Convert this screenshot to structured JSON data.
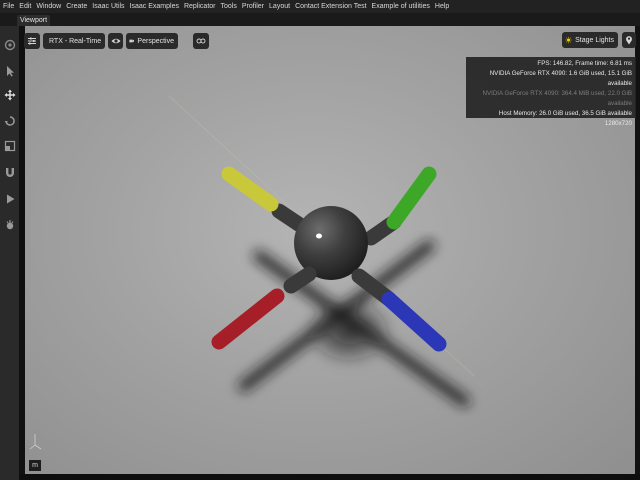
{
  "menubar": {
    "items": [
      {
        "label": "File"
      },
      {
        "label": "Edit"
      },
      {
        "label": "Window"
      },
      {
        "label": "Create"
      },
      {
        "label": "Isaac Utils"
      },
      {
        "label": "Isaac Examples"
      },
      {
        "label": "Replicator"
      },
      {
        "label": "Tools"
      },
      {
        "label": "Profiler"
      },
      {
        "label": "Layout"
      },
      {
        "label": "Contact Extension Test"
      },
      {
        "label": "Example of utilities"
      },
      {
        "label": "Help"
      }
    ]
  },
  "tabs": {
    "active": "Viewport"
  },
  "toolbar": {
    "tools": [
      {
        "icon": "orbit-icon"
      },
      {
        "icon": "select-arrow-icon"
      },
      {
        "icon": "move-icon"
      },
      {
        "icon": "rotate-icon"
      },
      {
        "icon": "scale-icon"
      },
      {
        "icon": "snap-magnet-icon"
      },
      {
        "icon": "play-icon"
      },
      {
        "icon": "physics-icon"
      }
    ]
  },
  "viewport": {
    "renderer_label": "RTX - Real-Time",
    "camera_label": "Perspective",
    "lights_label": "Stage Lights",
    "stats": {
      "fps_line": "FPS: 146.82, Frame time: 6.81 ms",
      "gpu0_line": "NVIDIA GeForce RTX 4090: 1.6 GiB used, 15.1 GiB available",
      "gpu1_line": "NVIDIA GeForce RTX 4090: 364.4 MiB used, 22.0 GiB available",
      "host_line": "Host Memory: 26.0 GiB used, 36.5 GiB available",
      "resolution_line": "1280x720"
    },
    "unit_label": "m",
    "colors": {
      "arm_yellow": "#c9c83a",
      "arm_green": "#3da828",
      "arm_red": "#a61e27",
      "arm_blue": "#2c37b8",
      "body": "#3b3b3b"
    }
  }
}
